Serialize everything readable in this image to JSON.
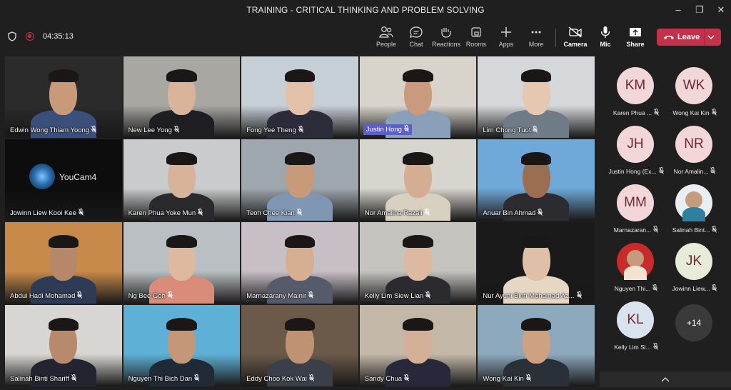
{
  "window": {
    "title": "TRAINING - CRITICAL THINKING AND PROBLEM SOLVING",
    "minimize": "–",
    "maximize": "❐",
    "close": "✕"
  },
  "toolbar": {
    "timer": "04:35:13",
    "buttons": [
      {
        "label": "People",
        "icon": "people-icon"
      },
      {
        "label": "Chat",
        "icon": "chat-icon"
      },
      {
        "label": "Reactions",
        "icon": "reactions-icon"
      },
      {
        "label": "Rooms",
        "icon": "rooms-icon"
      },
      {
        "label": "Apps",
        "icon": "apps-icon"
      },
      {
        "label": "More",
        "icon": "more-icon"
      }
    ],
    "camera": "Camera",
    "mic": "Mic",
    "share": "Share",
    "leave": "Leave"
  },
  "tiles": [
    {
      "name": "Edwin Wong Thiam Yoong",
      "bg": "#2b2b2b",
      "skin": "#c99a7a",
      "shirt": "#3a4f7a"
    },
    {
      "name": "New Lee Yong",
      "bg": "#a8a7a2",
      "skin": "#d9b49b",
      "shirt": "#1e1e22"
    },
    {
      "name": "Fong Yee Theng",
      "bg": "#c7cfd6",
      "skin": "#e3c1a8",
      "shirt": "#2a2c3a"
    },
    {
      "name": "Justin Hong",
      "bg": "#d8d4cc",
      "skin": "#c99a7c",
      "shirt": "#8aa0b8"
    },
    {
      "name": "Lim Chong Tuot",
      "bg": "#d5d8da",
      "skin": "#e6c7b0",
      "shirt": "#6f7b86"
    },
    {
      "name": "Jowinn Liew Kooi Kee",
      "bg": "#0d0d0d",
      "skin": "#2b6fb0",
      "shirt": "#0d0d0d",
      "overlay": "YouCam4"
    },
    {
      "name": "Karen Phua Yoke Mun",
      "bg": "#c9cbcc",
      "skin": "#d7b39a",
      "shirt": "#2a2a2e"
    },
    {
      "name": "Teoh Chee Kian",
      "bg": "#9ea7ad",
      "skin": "#c79a7a",
      "shirt": "#7f96b5"
    },
    {
      "name": "Nor Amalina Razali",
      "bg": "#d8d5cf",
      "skin": "#d5ad92",
      "shirt": "#d8d0c0"
    },
    {
      "name": "Anuar Bin Ahmad",
      "bg": "#6fa9d9",
      "skin": "#9a6e52",
      "shirt": "#2b2b30"
    },
    {
      "name": "Abdul Hadi Mohamad",
      "bg": "#c88a4a",
      "skin": "#b78769",
      "shirt": "#2e3b55"
    },
    {
      "name": "Ng Bee Goh",
      "bg": "#b9bfc3",
      "skin": "#ddb9a0",
      "shirt": "#d98c7a"
    },
    {
      "name": "Marnazarany Mainir",
      "bg": "#c8bfc6",
      "skin": "#d6ae92",
      "shirt": "#555b6a"
    },
    {
      "name": "Kelly Lim Siew Lian",
      "bg": "#c5c3be",
      "skin": "#dcb9a0",
      "shirt": "#2b2a2e"
    },
    {
      "name": "Nur Ayuni Binti Mohamad Az...",
      "bg": "#1a1a1a",
      "skin": "#e0bfa8",
      "shirt": "#e6d7c5"
    },
    {
      "name": "Salinah Binti Shariff",
      "bg": "#d8d6d2",
      "skin": "#b88a6c",
      "shirt": "#242430"
    },
    {
      "name": "Nguyen Thi Bich Dan",
      "bg": "#5fb0d6",
      "skin": "#c59779",
      "shirt": "#1f2a36"
    },
    {
      "name": "Eddy Choo Kok Wai",
      "bg": "#6b5a4a",
      "skin": "#bf9274",
      "shirt": "#3a3f4a"
    },
    {
      "name": "Sandy Chua",
      "bg": "#c3b8a8",
      "skin": "#d5b098",
      "shirt": "#28283a"
    },
    {
      "name": "Wong Kai Kin",
      "bg": "#8da9bd",
      "skin": "#cfa183",
      "shirt": "#2a2f38"
    }
  ],
  "highlight_tile": "Justin Hong",
  "people": [
    {
      "initials": "KM",
      "name": "Karen Phua ...",
      "color": "#f3d6d8"
    },
    {
      "initials": "WK",
      "name": "Wong Kai Kin",
      "color": "#f3d6d8"
    },
    {
      "initials": "JH",
      "name": "Justin Hong (Ex...",
      "color": "#f3d6d8"
    },
    {
      "initials": "NR",
      "name": "Nor Amalin...",
      "color": "#f3d6d8"
    },
    {
      "initials": "MM",
      "name": "Marnazaran...",
      "color": "#f3d6d8"
    },
    {
      "initials": "",
      "name": "Salinah Bint...",
      "color": "#e9eef2",
      "photo": true
    },
    {
      "initials": "",
      "name": "Nguyen Thi...",
      "color": "#c92a2a",
      "photo": true
    },
    {
      "initials": "JK",
      "name": "Jowinn Liew...",
      "color": "#e6ecd7"
    },
    {
      "initials": "KL",
      "name": "Kelly Lim Si...",
      "color": "#d9e3ee"
    }
  ],
  "overflow_count": "+14",
  "colors": {
    "leave": "#c4314b",
    "highlight": "#5b5fc7",
    "background": "#1f1f1f"
  }
}
